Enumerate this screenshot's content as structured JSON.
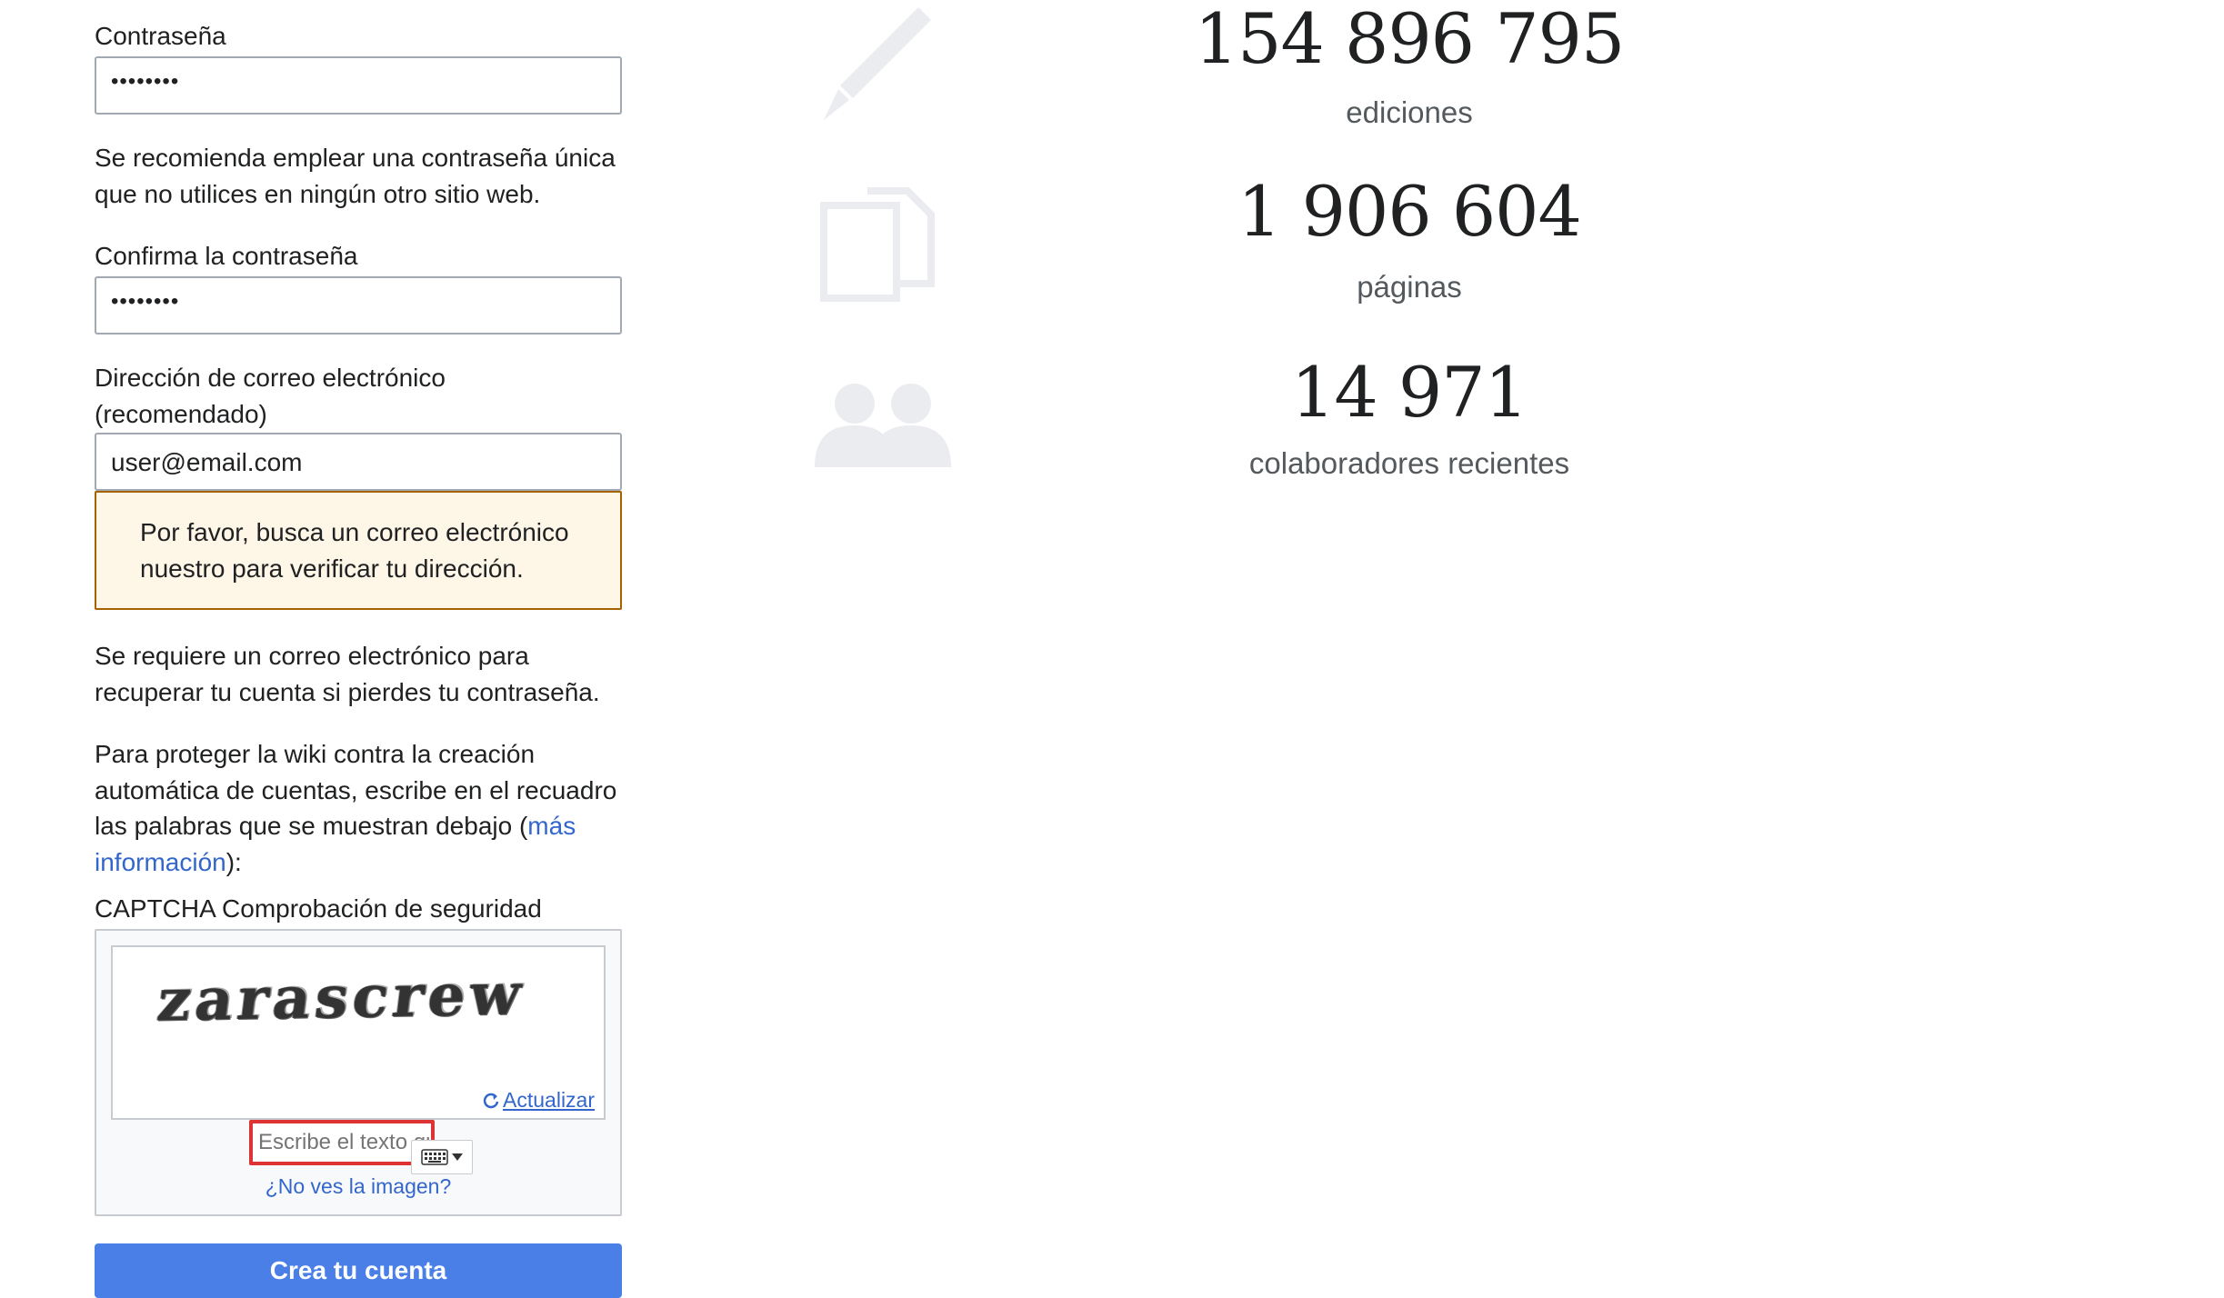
{
  "form": {
    "password_label": "Contraseña",
    "password_value": "••••••••",
    "password_hint": "Se recomienda emplear una contraseña única que no utilices en ningún otro sitio web.",
    "confirm_label": "Confirma la contraseña",
    "confirm_value": "••••••••",
    "email_label": "Dirección de correo electrónico (recomendado)",
    "email_value": "user@email.com",
    "email_warning": "Por favor, busca un correo electrónico nuestro para verificar tu dirección.",
    "email_help": "Se requiere un correo electrónico para recuperar tu cuenta si pierdes tu contraseña.",
    "captcha_intro_before": "Para proteger la wiki contra la creación automática de cuentas, escribe en el recuadro las palabras que se muestran debajo (",
    "captcha_intro_link": "más información",
    "captcha_intro_after": "):",
    "captcha_label": "CAPTCHA Comprobación de seguridad",
    "captcha_word": "zarascrew",
    "captcha_refresh": "Actualizar",
    "captcha_placeholder": "Escribe el texto que ves",
    "captcha_noimage": "¿No ves la imagen?",
    "submit_label": "Crea tu cuenta"
  },
  "stats": [
    {
      "number": "154 896 795",
      "label": "ediciones",
      "icon": "pencil-icon"
    },
    {
      "number": "1 906 604",
      "label": "páginas",
      "icon": "pages-icon"
    },
    {
      "number": "14 971",
      "label": "colaboradores recientes",
      "icon": "users-icon"
    }
  ],
  "colors": {
    "link": "#3366cc",
    "warning_bg": "#fef6e7",
    "warning_border": "#a66200",
    "button": "#4a7fe8",
    "icon_gray": "#eaecf0"
  }
}
